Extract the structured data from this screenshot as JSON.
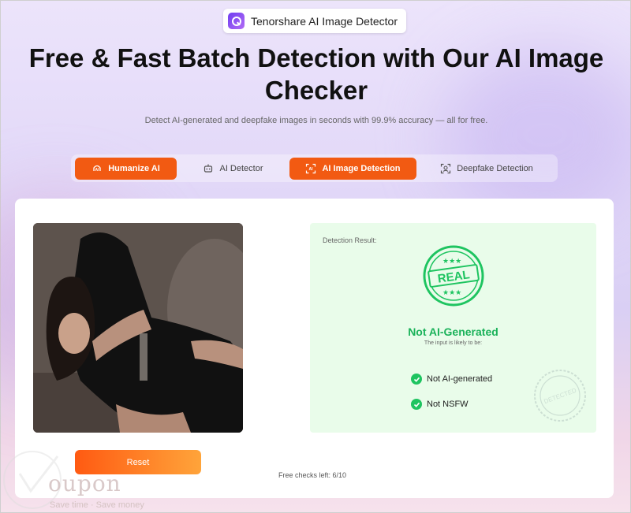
{
  "brand": {
    "name": "Tenorshare AI Image Detector",
    "icon": "tenorshare-logo"
  },
  "hero": {
    "title": "Free & Fast Batch Detection with Our AI Image Checker",
    "subtitle": "Detect AI-generated and deepfake images in seconds with 99.9% accuracy — all for free."
  },
  "tabs": [
    {
      "label": "Humanize AI",
      "icon": "ai-humanize-icon",
      "active": true
    },
    {
      "label": "AI Detector",
      "icon": "robot-icon",
      "active": false
    },
    {
      "label": "AI Image Detection",
      "icon": "ai-scan-icon",
      "active": true
    },
    {
      "label": "Deepfake Detection",
      "icon": "face-scan-icon",
      "active": false
    }
  ],
  "result": {
    "label": "Detection Result:",
    "stamp_text": "REAL",
    "verdict": "Not AI-Generated",
    "verdict_sub": "The input is likely to be:",
    "checks": [
      "Not AI-generated",
      "Not NSFW"
    ],
    "seal_text": "DETECTED"
  },
  "actions": {
    "reset_label": "Reset",
    "free_checks": "Free checks left: 6/10"
  },
  "watermark": {
    "text": "oupon",
    "tagline": "Save time · Save money"
  },
  "colors": {
    "accent": "#f25a12",
    "success": "#1bb25a",
    "panel": "#e9fcea"
  }
}
